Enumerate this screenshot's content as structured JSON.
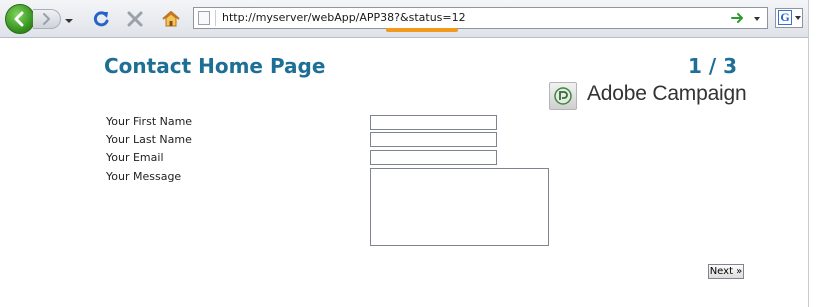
{
  "browser": {
    "address": "http://myserver/webApp/APP38?&status=12",
    "search_engine_letter": "G",
    "colors": {
      "back_button": "#2f8a1a",
      "reload": "#2563c9",
      "stop": "#9aa1aa",
      "home": "#e5a21b",
      "highlight": "#f29a1d",
      "go_arrow": "#2e9a2e"
    }
  },
  "page": {
    "title": "Contact Home Page",
    "counter": "1 / 3",
    "logo_text": "Adobe Campaign",
    "title_color": "#1d6f96"
  },
  "form": {
    "fields": [
      {
        "label": "Your First Name",
        "value": ""
      },
      {
        "label": "Your Last Name",
        "value": ""
      },
      {
        "label": "Your Email",
        "value": ""
      },
      {
        "label": "Your Message",
        "value": ""
      }
    ],
    "next_label": "Next »"
  }
}
